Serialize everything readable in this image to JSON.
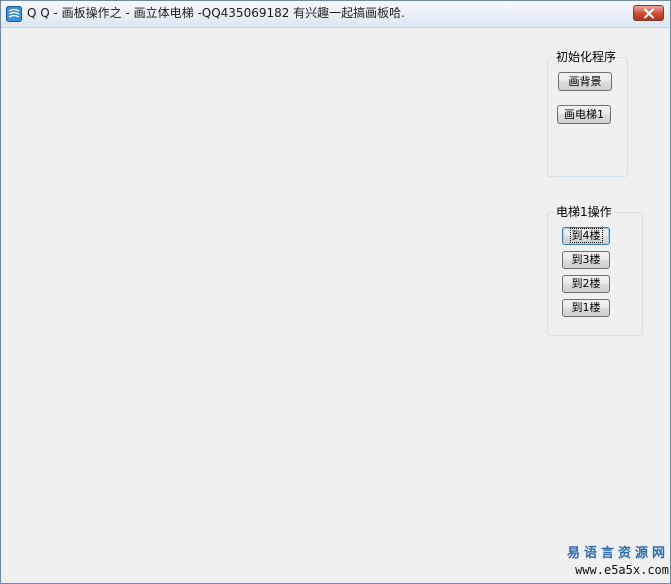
{
  "window": {
    "title": "Q Q - 画板操作之 - 画立体电梯 -QQ435069182 有兴趣一起搞画板哈.",
    "icon": "app-icon"
  },
  "init_group": {
    "title": "初始化程序",
    "buttons": {
      "draw_background": "画背景",
      "draw_elevator": "画电梯1"
    }
  },
  "elevator_group": {
    "title": "电梯1操作",
    "buttons": {
      "floor4": "到4楼",
      "floor3": "到3楼",
      "floor2": "到2楼",
      "floor1": "到1楼"
    }
  },
  "watermark": {
    "line1": "易语言资源网",
    "line2": "www.e5a5x.com"
  },
  "colors": {
    "close_button": "#cc4a35",
    "watermark_accent": "#2b6cb3",
    "window_background": "#f0f0f0"
  }
}
